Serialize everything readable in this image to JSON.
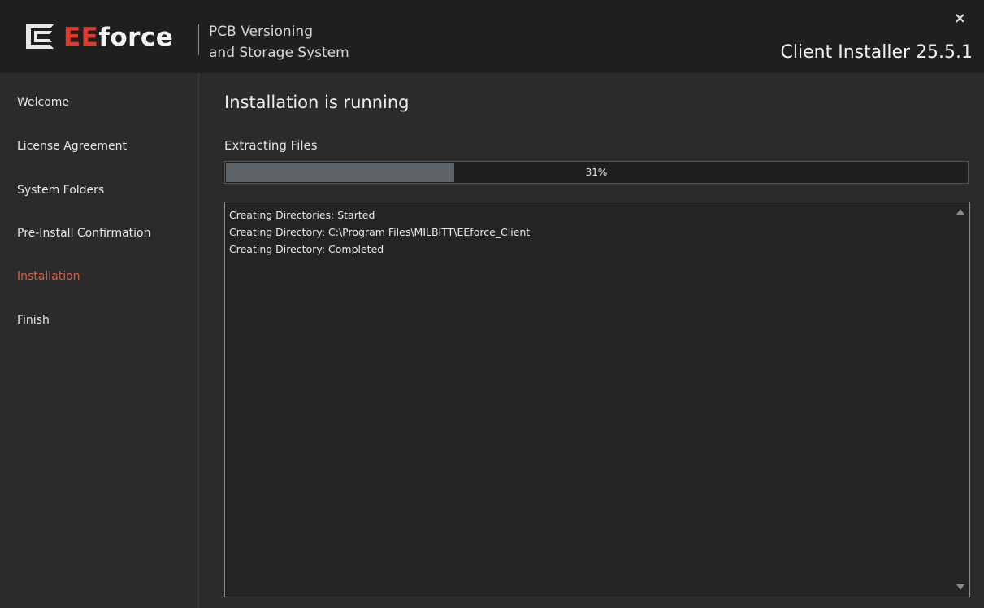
{
  "header": {
    "logo": {
      "part1": "EE",
      "part2": "force"
    },
    "tagline_line1": "PCB Versioning",
    "tagline_line2": "and Storage System",
    "installer_title": "Client Installer 25.5.1",
    "close_label": "×"
  },
  "sidebar": {
    "items": [
      {
        "label": "Welcome"
      },
      {
        "label": "License Agreement"
      },
      {
        "label": "System Folders"
      },
      {
        "label": "Pre-Install Confirmation"
      },
      {
        "label": "Installation"
      },
      {
        "label": "Finish"
      }
    ],
    "active_index": 4,
    "active_color": "#e25b3f"
  },
  "main": {
    "title": "Installation is running",
    "step_label": "Extracting Files",
    "progress": {
      "percent": 31,
      "label": "31%"
    },
    "log": [
      "Creating Directories: Started",
      "Creating Directory: C:\\Program Files\\MILBITT\\EEforce_Client",
      "Creating Directory: Completed"
    ]
  },
  "icons": [
    "eeforce-logo-icon",
    "close-icon",
    "scroll-up-icon",
    "scroll-down-icon"
  ]
}
